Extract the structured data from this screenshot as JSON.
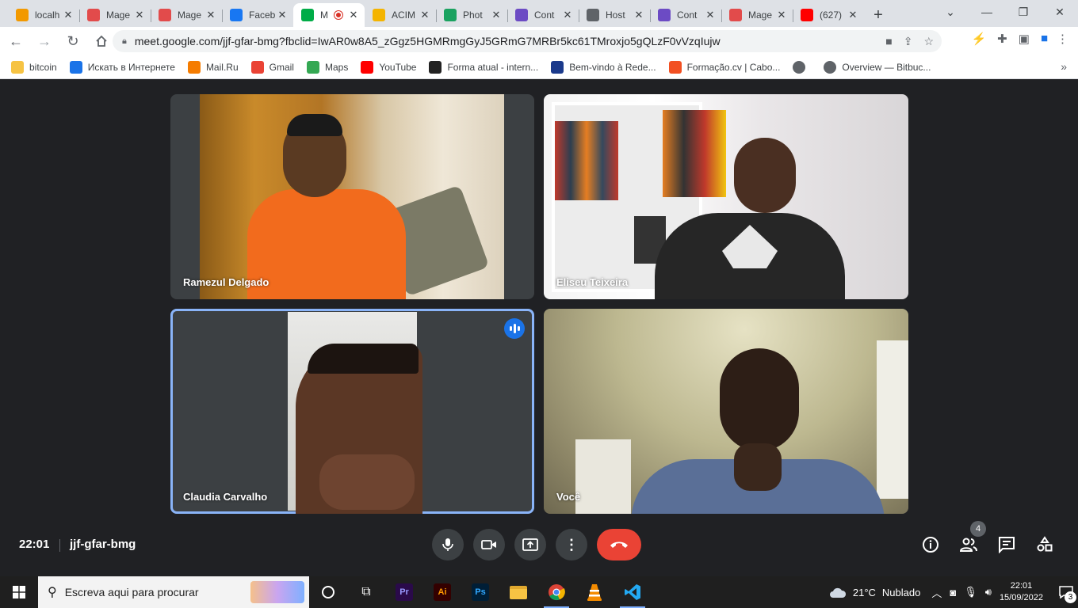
{
  "browser": {
    "tabs": [
      {
        "title": "localh",
        "favicon_color": "#f29900",
        "favicon": "pma-icon"
      },
      {
        "title": "Mage",
        "favicon_color": "#e24b4b",
        "favicon": "magento-icon"
      },
      {
        "title": "Mage",
        "favicon_color": "#e24b4b",
        "favicon": "magento-icon"
      },
      {
        "title": "Faceb",
        "favicon_color": "#1877f2",
        "favicon": "facebook-icon"
      },
      {
        "title": "M",
        "favicon_color": "#00ac47",
        "favicon": "google-meet-icon",
        "active": true
      },
      {
        "title": "ACIM",
        "favicon_color": "#f4b400",
        "favicon": "acim-icon"
      },
      {
        "title": "Phot",
        "favicon_color": "#1aa260",
        "favicon": "photopea-icon"
      },
      {
        "title": "Cont",
        "favicon_color": "#6c4bc4",
        "favicon": "hostinger-icon"
      },
      {
        "title": "Host",
        "favicon_color": "#5f6368",
        "favicon": "globe-icon"
      },
      {
        "title": "Cont",
        "favicon_color": "#6c4bc4",
        "favicon": "hostinger-icon"
      },
      {
        "title": "Mage",
        "favicon_color": "#e24b4b",
        "favicon": "magento-icon"
      },
      {
        "title": "(627)",
        "favicon_color": "#ff0000",
        "favicon": "youtube-icon"
      }
    ],
    "url": "meet.google.com/jjf-gfar-bmg?fbclid=IwAR0w8A5_zGgz5HGMRmgGyJ5GRmG7MRBr5kc61TMroxjo5gQLzF0vVzqIujw",
    "bookmarks": [
      {
        "label": "bitcoin",
        "icon": "folder-icon",
        "color": "#f6c343"
      },
      {
        "label": "Искать в Интернете",
        "icon": "search-icon",
        "color": "#1a73e8"
      },
      {
        "label": "Mail.Ru",
        "icon": "mailru-icon",
        "color": "#f57c00"
      },
      {
        "label": "Gmail",
        "icon": "gmail-icon",
        "color": "#ea4335"
      },
      {
        "label": "Maps",
        "icon": "maps-icon",
        "color": "#34a853"
      },
      {
        "label": "YouTube",
        "icon": "youtube-icon",
        "color": "#ff0000"
      },
      {
        "label": "Forma atual - intern...",
        "icon": "tm-icon",
        "color": "#222222"
      },
      {
        "label": "Bem-vindo à Rede...",
        "icon": "rede-icon",
        "color": "#1b3a8c"
      },
      {
        "label": "Formação.cv | Cabo...",
        "icon": "windows-icon",
        "color": "#f25022"
      },
      {
        "label": "",
        "icon": "globe-icon",
        "color": "#5f6368"
      },
      {
        "label": "Overview — Bitbuc...",
        "icon": "globe-icon",
        "color": "#5f6368"
      }
    ]
  },
  "meet": {
    "participants": [
      {
        "name": "Ramezul Delgado",
        "speaking": false
      },
      {
        "name": "Eliseu Teixeira",
        "speaking": false
      },
      {
        "name": "Claudia Carvalho",
        "speaking": true
      },
      {
        "name": "Você",
        "speaking": false
      }
    ],
    "time": "22:01",
    "meeting_code": "jjf-gfar-bmg",
    "participant_count": "4",
    "end_call_color": "#ea4335"
  },
  "taskbar": {
    "search_placeholder": "Escreva aqui para procurar",
    "apps": [
      {
        "name": "task-view",
        "label": ""
      },
      {
        "name": "premiere-pro",
        "label": "Pr",
        "bg": "#2a0a4a",
        "fg": "#9999ff"
      },
      {
        "name": "illustrator",
        "label": "Ai",
        "bg": "#330000",
        "fg": "#ff9a00"
      },
      {
        "name": "photoshop",
        "label": "Ps",
        "bg": "#001e36",
        "fg": "#31a8ff"
      },
      {
        "name": "file-explorer",
        "label": ""
      },
      {
        "name": "chrome",
        "label": ""
      },
      {
        "name": "vlc",
        "label": ""
      },
      {
        "name": "vscode",
        "label": ""
      }
    ],
    "weather": {
      "temp": "21°C",
      "condition": "Nublado"
    },
    "clock_time": "22:01",
    "clock_date": "15/09/2022",
    "notification_count": "3"
  }
}
